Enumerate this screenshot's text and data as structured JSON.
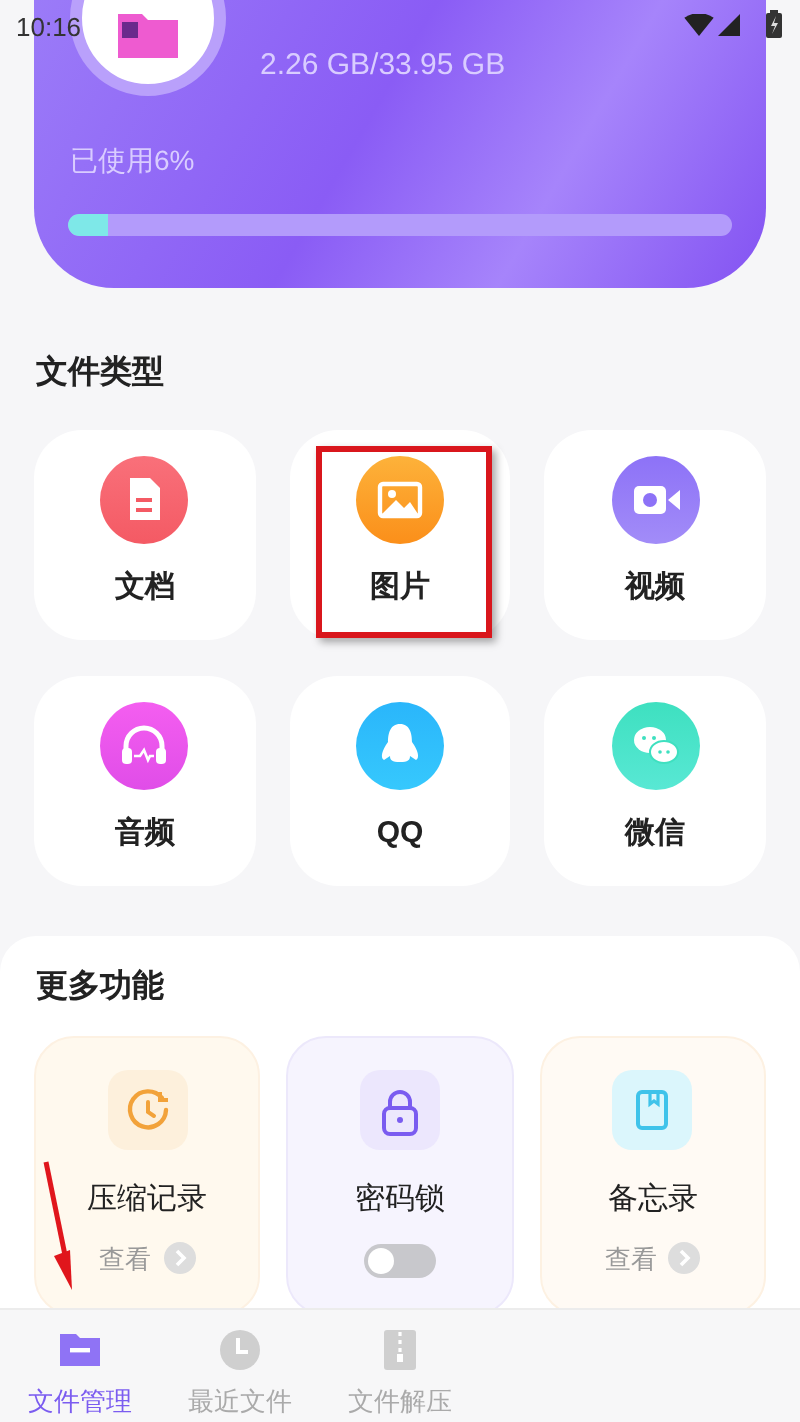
{
  "status_bar": {
    "time": "10:16"
  },
  "storage": {
    "size": "2.26 GB/33.95 GB",
    "used_label": "已使用6%",
    "level": 0.06
  },
  "file_types": {
    "title": "文件类型",
    "items": [
      {
        "kind": "document",
        "label": "文档",
        "highlighted": false
      },
      {
        "kind": "image",
        "label": "图片",
        "highlighted": true
      },
      {
        "kind": "video",
        "label": "视频",
        "highlighted": false
      },
      {
        "kind": "audio",
        "label": "音频",
        "highlighted": false
      },
      {
        "kind": "qq",
        "label": "QQ",
        "highlighted": false
      },
      {
        "kind": "wechat",
        "label": "微信",
        "highlighted": false
      }
    ]
  },
  "more_features": {
    "title": "更多功能",
    "items": [
      {
        "kind": "link",
        "label": "压缩记录",
        "action": "查看"
      },
      {
        "kind": "toggle",
        "label": "密码锁",
        "on": false
      },
      {
        "kind": "link",
        "label": "备忘录",
        "action": "查看"
      }
    ]
  },
  "annotation_arrow": true,
  "bottom_nav": [
    {
      "label": "文件管理",
      "selected": true
    },
    {
      "label": "最近文件",
      "selected": false
    },
    {
      "label": "文件解压",
      "selected": false
    }
  ]
}
